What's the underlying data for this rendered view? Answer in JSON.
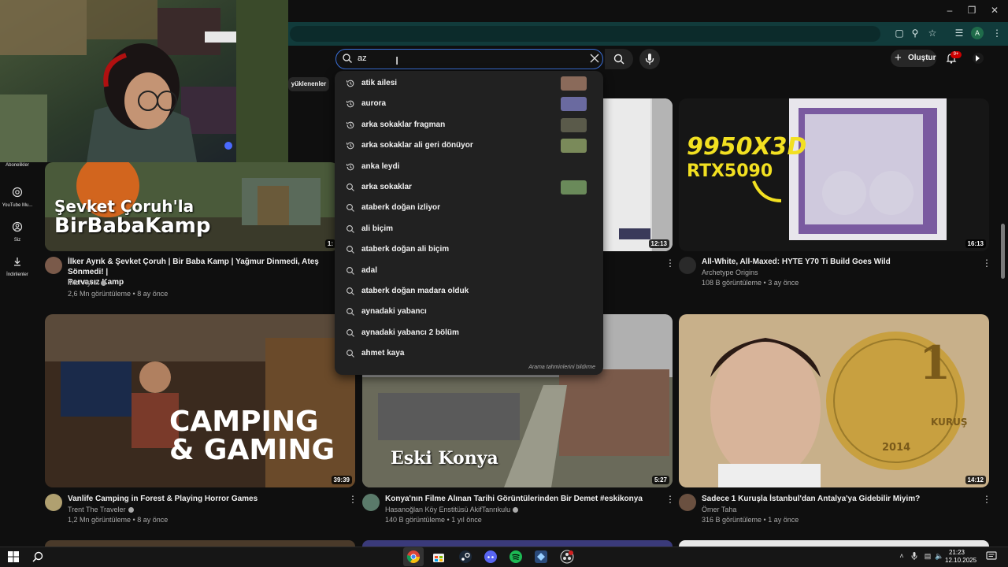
{
  "search": {
    "query": "az",
    "suggestions": [
      {
        "text": "atik ailesi",
        "type": "history",
        "thumb": true
      },
      {
        "text": "aurora",
        "type": "history",
        "thumb": true
      },
      {
        "text": "arka sokaklar fragman",
        "type": "history",
        "thumb": true
      },
      {
        "text": "arka sokaklar ali geri dönüyor",
        "type": "history",
        "thumb": true
      },
      {
        "text": "anka leydi",
        "type": "history",
        "thumb": false
      },
      {
        "text": "arka sokaklar",
        "type": "search",
        "thumb": true
      },
      {
        "text": "ataberk doğan izliyor",
        "type": "search",
        "thumb": false
      },
      {
        "text": "ali biçim",
        "type": "search",
        "thumb": false
      },
      {
        "text": "ataberk doğan ali biçim",
        "type": "search",
        "thumb": false
      },
      {
        "text": "adal",
        "type": "search",
        "thumb": false
      },
      {
        "text": "ataberk doğan madara olduk",
        "type": "search",
        "thumb": false
      },
      {
        "text": "aynadaki yabancı",
        "type": "search",
        "thumb": false
      },
      {
        "text": "aynadaki yabancı 2 bölüm",
        "type": "search",
        "thumb": false
      },
      {
        "text": "ahmet kaya",
        "type": "search",
        "thumb": false
      }
    ],
    "report_label": "Arama tahminlerini bildirme"
  },
  "topbar": {
    "create_label": "Oluştur",
    "notif_count": "9+"
  },
  "chip": {
    "label": "yüklenenler"
  },
  "sidebar": {
    "items": [
      {
        "label": "Abonelikler"
      },
      {
        "label": "YouTube Mu..."
      },
      {
        "label": "Siz"
      },
      {
        "label": "İndirilenler"
      }
    ]
  },
  "videos": {
    "row1": [
      {
        "title": "İlker Ayrık & Şevket Çoruh | Bir Baba Kamp | Yağmur Dinmedi, Ateş Sönmedi! |",
        "title2": "Pervasız Kamp",
        "channel": "İlker Ayrık",
        "meta": "2,6 Mn görüntüleme • 8 ay önce",
        "overlay1": "Şevket Çoruh'la",
        "overlay2": "BirBabaKamp",
        "duration": "1:"
      },
      {
        "duration": "12:13"
      },
      {
        "title": "All-White, All-Maxed: HYTE Y70 Ti Build Goes Wild",
        "channel": "Archetype Origins",
        "meta": "108 B görüntüleme • 3 ay önce",
        "overlay1": "9950X3D",
        "overlay2": "RTX5090",
        "duration": "16:13"
      }
    ],
    "row2": [
      {
        "title": "Vanlife Camping in Forest & Playing Horror Games",
        "channel": "Trent The Traveler",
        "meta": "1,2 Mn görüntüleme • 8 ay önce",
        "overlay1": "CAMPING",
        "overlay2": "& GAMING",
        "duration": "39:39"
      },
      {
        "title": "Konya'nın Filme Alınan Tarihi Görüntülerinden Bir Demet #eskikonya",
        "channel": "Hasanoğlan Köy Enstitüsü AkifTanrıkulu",
        "meta": "140 B görüntüleme • 1 yıl önce",
        "overlay1": "Eski Konya",
        "duration": "5:27"
      },
      {
        "title": "Sadece 1 Kuruşla İstanbul'dan Antalya'ya Gidebilir Miyim?",
        "channel": "Ömer Taha",
        "meta": "316 B görüntüleme • 1 ay önce",
        "coin_num": "1",
        "coin_word": "KURUŞ",
        "coin_year": "2014",
        "duration": "14:12"
      }
    ]
  },
  "taskbar": {
    "time": "21:23",
    "date": "12.10.2025"
  },
  "colors": {
    "accent": "#3a6fd8",
    "browser_bar": "#113b3b",
    "dropdown_bg": "#212121",
    "page_bg": "#0f0f0f"
  }
}
